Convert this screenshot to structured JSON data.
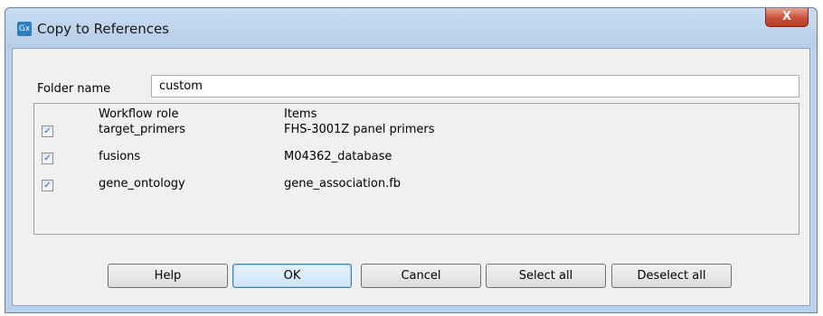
{
  "window": {
    "icon_text": "Gx",
    "title": "Copy to References",
    "close_glyph": "X"
  },
  "folder": {
    "label": "Folder name",
    "value": "custom"
  },
  "table": {
    "headers": {
      "role": "Workflow role",
      "items": "Items"
    },
    "rows": [
      {
        "checked": true,
        "role": "target_primers",
        "item": "FHS-3001Z panel primers"
      },
      {
        "checked": true,
        "role": "fusions",
        "item": "M04362_database"
      },
      {
        "checked": true,
        "role": "gene_ontology",
        "item": "gene_association.fb"
      }
    ]
  },
  "buttons": {
    "help": "Help",
    "ok": "OK",
    "cancel": "Cancel",
    "select_all": "Select all",
    "deselect_all": "Deselect all"
  },
  "check_glyph": "✓"
}
